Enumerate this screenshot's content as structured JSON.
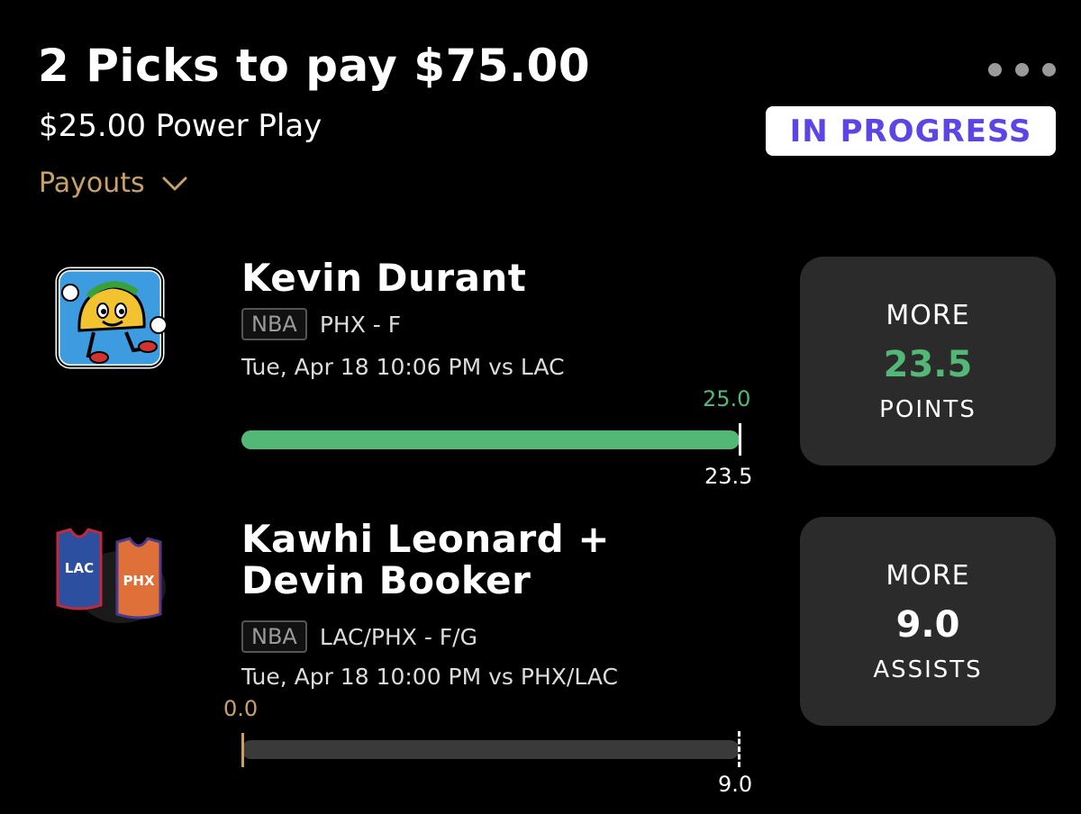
{
  "header": {
    "title": "2 Picks to pay $75.00",
    "subtitle": "$25.00 Power Play",
    "payouts_label": "Payouts",
    "status": "IN PROGRESS",
    "colors": {
      "accent_gold": "#c9a066",
      "status_text": "#5b45e6",
      "progress_green": "#53b776"
    }
  },
  "picks": [
    {
      "player": "Kevin Durant",
      "league": "NBA",
      "team_position": "PHX - F",
      "game_time": "Tue, Apr 18 10:06 PM  vs LAC",
      "current_value_label": "25.0",
      "line_label": "23.5",
      "progress": 1.0,
      "direction": "MORE",
      "line": "23.5",
      "stat": "POINTS",
      "avatar_icon": "taco-mascot-icon"
    },
    {
      "player": "Kawhi Leonard + Devin Booker",
      "league": "NBA",
      "team_position": "LAC/PHX - F/G",
      "game_time": "Tue, Apr 18 10:00 PM  vs PHX/LAC",
      "current_value_label": "0.0",
      "line_label": "9.0",
      "progress": 0.0,
      "direction": "MORE",
      "line": "9.0",
      "stat": "ASSISTS",
      "avatar_icon": "jerseys-icon",
      "jersey_labels": [
        "LAC",
        "PHX"
      ]
    }
  ]
}
